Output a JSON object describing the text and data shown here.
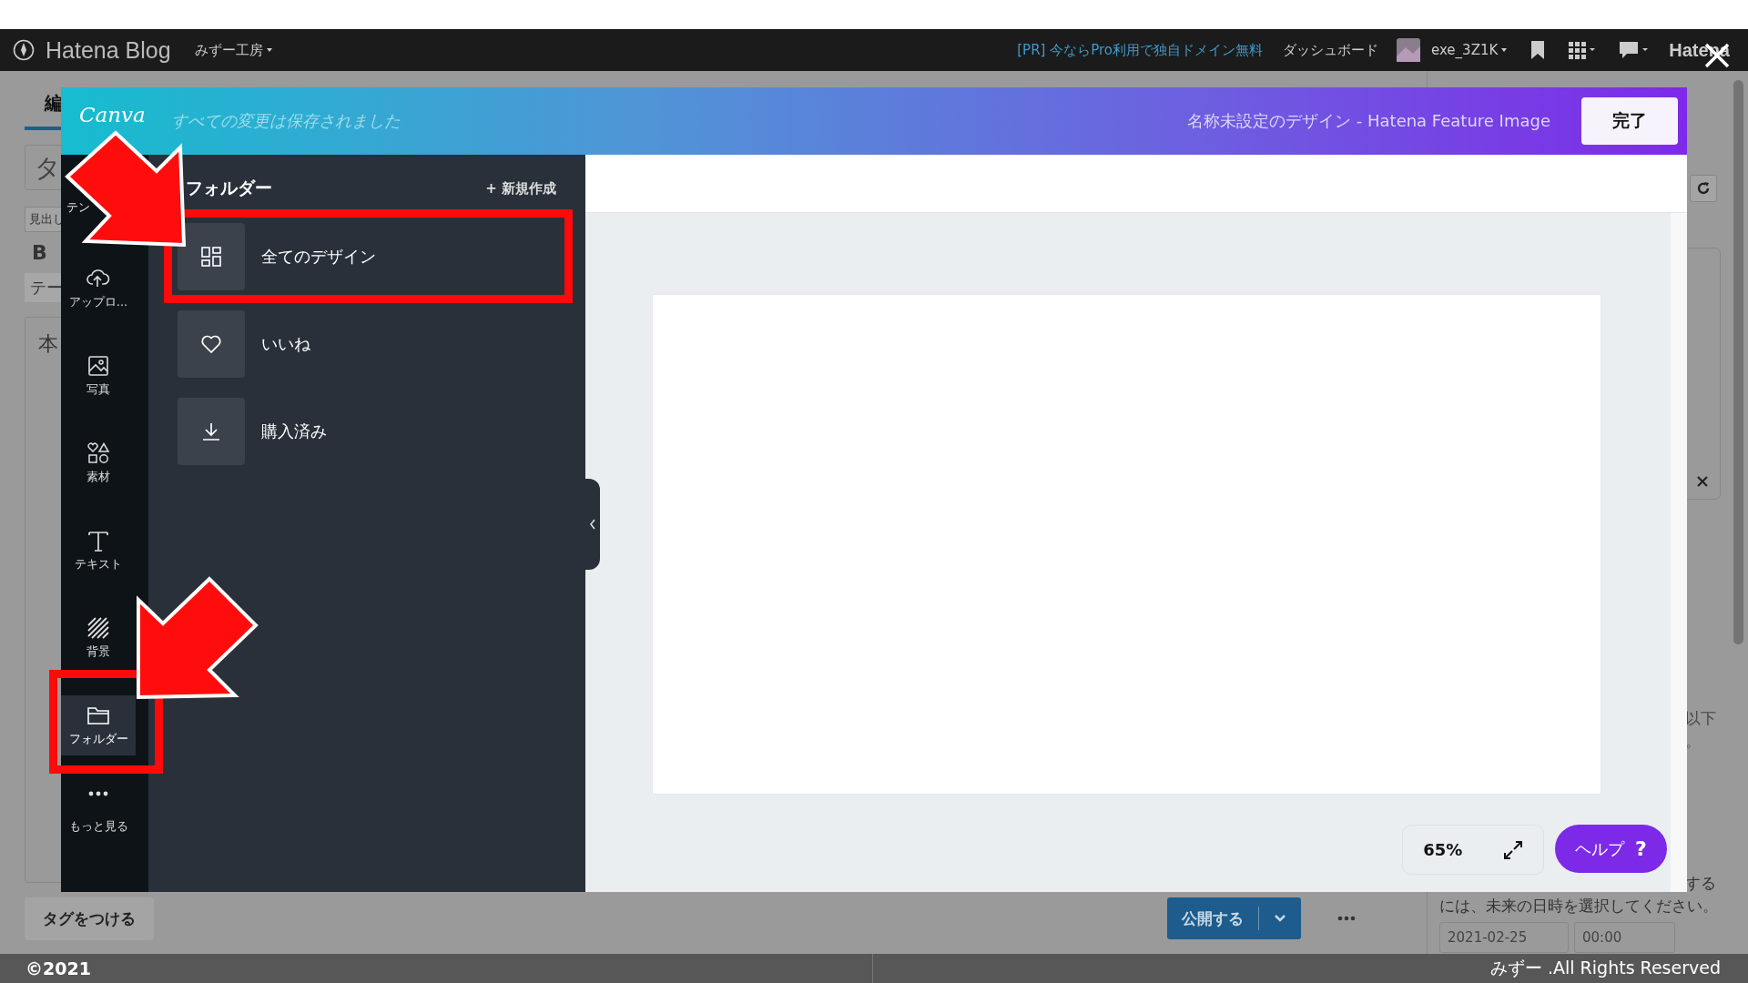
{
  "top_bar": {
    "logo": "Hatena Blog",
    "blog_menu": "みずー工房",
    "promo": "[PR] 今ならPro利用で独自ドメイン無料",
    "dashboard": "ダッシュボード",
    "user": "exe_3Z1K",
    "brand": "Hatena"
  },
  "editor": {
    "tab": "編",
    "title_field": "タ",
    "format_menu": "見出し",
    "bold_button": "B",
    "toolbar_item": "テー",
    "body_field": "本",
    "tag_button": "タグをつける",
    "publish_button": "公開する"
  },
  "sidebar": {
    "note_lines": [
      "以下",
      "。"
    ],
    "schedule_tail": "する",
    "schedule_hint": "には、未来の日時を選択してください。",
    "date": "2021-02-25",
    "time": "00:00"
  },
  "footer": {
    "copyright": "©2021",
    "rights": "みずー .All Rights Reserved"
  },
  "modal": {
    "logo": "Canva",
    "save_status": "すべての変更は保存されました",
    "design_title": "名称未設定のデザイン - Hatena Feature Image",
    "done_button": "完了",
    "rail": [
      {
        "label": "テン",
        "kind": "template",
        "selected": false
      },
      {
        "label": "アップロ...",
        "kind": "upload",
        "selected": false
      },
      {
        "label": "写真",
        "kind": "photo",
        "selected": false
      },
      {
        "label": "素材",
        "kind": "elements",
        "selected": false
      },
      {
        "label": "テキスト",
        "kind": "text",
        "selected": false
      },
      {
        "label": "背景",
        "kind": "background",
        "selected": false
      },
      {
        "label": "フォルダー",
        "kind": "folder",
        "selected": true
      },
      {
        "label": "もっと見る",
        "kind": "more",
        "selected": false
      }
    ],
    "panel": {
      "title": "フォルダー",
      "new_button": "+ 新規作成",
      "items": [
        {
          "label": "全てのデザイン",
          "kind": "grid"
        },
        {
          "label": "いいね",
          "kind": "heart"
        },
        {
          "label": "購入済み",
          "kind": "download"
        }
      ]
    },
    "zoom": "65%",
    "help_button": "ヘルプ",
    "help_mark": "?"
  }
}
